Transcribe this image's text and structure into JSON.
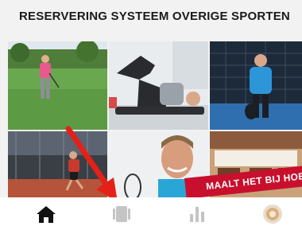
{
  "header": {
    "title": "RESERVERING SYSTEEM OVERIGE SPORTEN"
  },
  "tiles": [
    {
      "name": "golf-tile",
      "label": "Golf"
    },
    {
      "name": "fitness-tile",
      "label": "Fitness"
    },
    {
      "name": "padel-tile",
      "label": "Padel"
    },
    {
      "name": "tennis-tile",
      "label": "Tennis"
    },
    {
      "name": "trainer-tile",
      "label": "Trainer"
    },
    {
      "name": "restaurant-tile",
      "label": "Restaurant"
    }
  ],
  "banner": {
    "text": "MAALT HET BIJ HOENDERDAAL"
  },
  "tabbar": {
    "items": [
      {
        "icon": "home-icon",
        "active": true
      },
      {
        "icon": "courts-icon",
        "active": false
      },
      {
        "icon": "bar-chart-icon",
        "active": false
      },
      {
        "icon": "profile-avatar-icon",
        "active": false
      }
    ]
  },
  "colors": {
    "accent_arrow": "#e32119",
    "banner": "#c8102e",
    "tab_active": "#111111",
    "tab_inactive": "#c4c4c4"
  }
}
